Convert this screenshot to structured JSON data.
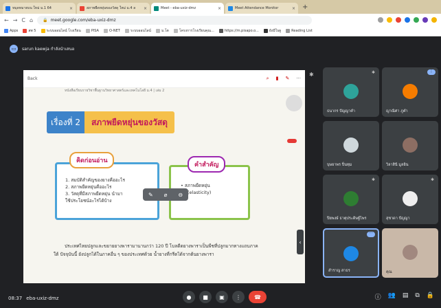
{
  "browser": {
    "tabs": [
      {
        "label": "หมุดหมายบน ใหม่ ม.1 64",
        "fav": "#1a73e8",
        "active": false
      },
      {
        "label": "สภาพยืดหยุ่นของวัสดุ ใหม่ ม.4 ล",
        "fav": "#ea4335",
        "active": false
      },
      {
        "label": "Meet - eba-uxiz-dmz",
        "fav": "#00897b",
        "active": true
      },
      {
        "label": "Meet Attendance Monitor",
        "fav": "#1e88e5",
        "active": false
      }
    ],
    "url": "meet.google.com/eba-uxiz-dmz",
    "bookmarks": [
      "Apps",
      "สพ 5",
      "ระบบออนไลน์ โรงเรียน",
      "PISA",
      "O-NET",
      "ระบบออนไลน์",
      "ม.โต",
      "โครงการโรงเรียนคุณ...",
      "https://m.pisapo.o...",
      "ยังมีในฐู",
      "Reading List"
    ]
  },
  "meet": {
    "presenter": "sarun kaewja กำลังนำเสนอ",
    "meeting_code": "eba-uxiz-dmz",
    "time": "08:37"
  },
  "slide": {
    "back": "Back",
    "book_note": "หนังสือเรียนรายวิชาพื้นฐานวิทยาศาสตร์และเทคโนโลยี ม.4 | เล่ม 2",
    "topic_num": "เรื่องที่ 2",
    "topic_title": "สภาพยืดหยุ่นของวัสดุ",
    "box1_title": "คิดก่อนอ่าน",
    "box1_items": [
      "1. สมบัติสำคัญของยางคืออะไร",
      "2. สภาพยืดหยุ่นคืออะไร",
      "3. วัสดุที่มีสภาพยืดหยุ่น นำมา",
      "   ใช้ประโยชน์อะไรได้บ้าง"
    ],
    "box2_title": "คำสำคัญ",
    "box2_item1": "• สภาพยืดหยุ่น",
    "box2_item2": "(elasticity)",
    "paragraph": "ประเทศไทยปลูกและขยายยางพารามานานกว่า 120 ปี โบลดีดยางพาราเป็นพืชที่ปลูกมากทางแถบภาคใต้ ปัจจุบันนี้ ยังปลูกได้ในภาคอื่น ๆ ของประเทศด้วย น้ำยางที่กรีดได้จากต้นยางพารา"
  },
  "participants": [
    {
      "name": "ธนากร ปัญญาคำ",
      "color": "#2ea39a",
      "muted": true
    },
    {
      "name": "ญาณิศา ภูคำ",
      "color": "#f57c00",
      "muted": false,
      "badge": true
    },
    {
      "name": "บุษยาพร ปิ่นทุม",
      "color": "#cfd8dc",
      "muted": false
    },
    {
      "name": "วิลาสินี มูลอิน",
      "color": "#8d6e63",
      "muted": false
    },
    {
      "name": "ปิยพงษ์ ธาตุประดิษฐ์ไพร",
      "color": "#2e7d32",
      "muted": true
    },
    {
      "name": "สุชาดา ปัญญา",
      "color": "#eeeeee",
      "muted": true
    },
    {
      "name": "สำราญ สาธร",
      "color": "#1e88e5",
      "muted": false,
      "active": true
    },
    {
      "name": "คุณ",
      "color": "#a1887f",
      "muted": false
    }
  ],
  "icons": {
    "mic": "mic-icon",
    "camera": "camera-icon",
    "present": "present-icon",
    "more": "more-icon",
    "end": "end-call-icon"
  }
}
